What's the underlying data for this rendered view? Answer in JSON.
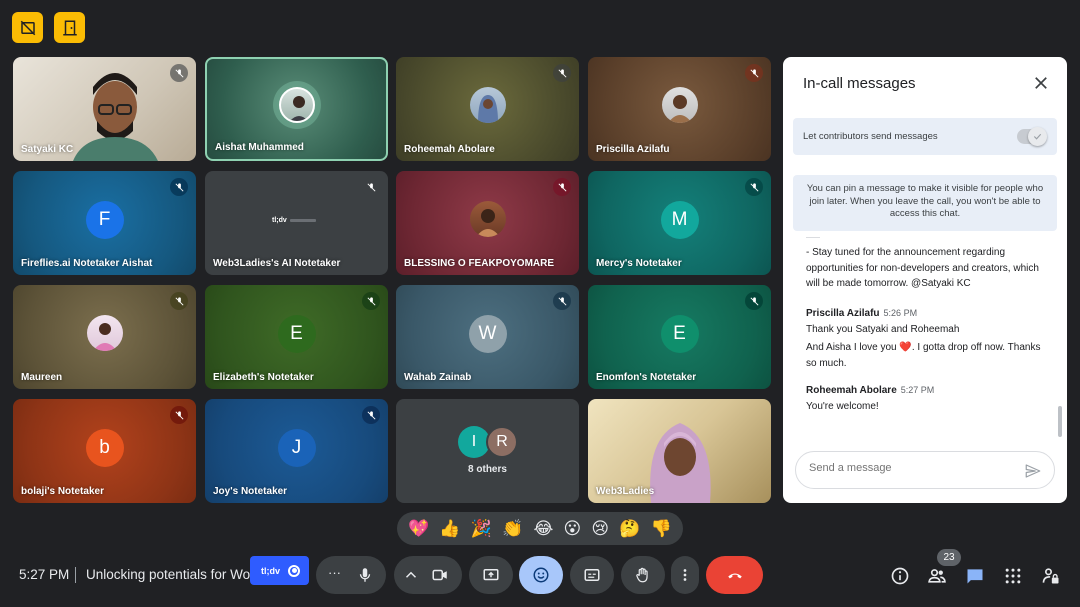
{
  "tiles": [
    {
      "name": "Satyaki KC",
      "muted": true
    },
    {
      "name": "Aishat Muhammed",
      "muted": false,
      "speaking": true
    },
    {
      "name": "Roheemah Abolare",
      "muted": true
    },
    {
      "name": "Priscilla Azilafu",
      "muted": true
    },
    {
      "name": "Fireflies.ai Notetaker Aishat",
      "initial": "F",
      "muted": true
    },
    {
      "name": "Web3Ladies's AI Notetaker",
      "muted": true,
      "logo_text": "tl;dv"
    },
    {
      "name": "BLESSING O FEAKPOYOMARE",
      "muted": true
    },
    {
      "name": "Mercy's Notetaker",
      "initial": "M",
      "muted": true
    },
    {
      "name": "Maureen",
      "muted": true
    },
    {
      "name": "Elizabeth's Notetaker",
      "initial": "E",
      "muted": true
    },
    {
      "name": "Wahab Zainab",
      "initial": "W",
      "muted": false
    },
    {
      "name": "Enomfon's Notetaker",
      "initial": "E",
      "muted": true
    },
    {
      "name": "bolaji's Notetaker",
      "initial": "b",
      "muted": true
    },
    {
      "name": "Joy's Notetaker",
      "initial": "J",
      "muted": true
    },
    {
      "name": "8 others",
      "initials": [
        "I",
        "R"
      ]
    },
    {
      "name": "Web3Ladies",
      "muted": false
    }
  ],
  "chat": {
    "title": "In-call messages",
    "setting_label": "Let contributors send messages",
    "setting_on": true,
    "pin_info": "You can pin a message to make it visible for people who join later. When you leave the call, you won't be able to access this chat.",
    "partial_line": "- Stay tuned for the announcement regarding opportunities for non-developers and creators, which will be made tomorrow. @Satyaki KC",
    "messages": [
      {
        "sender": "Priscilla Azilafu",
        "time": "5:26 PM",
        "lines": [
          "Thank you Satyaki and Roheemah",
          "And Aisha I love you ❤️. I gotta drop off now. Thanks so much."
        ]
      },
      {
        "sender": "Roheemah Abolare",
        "time": "5:27 PM",
        "lines": [
          "You're welcome!"
        ]
      }
    ],
    "compose_placeholder": "Send a message"
  },
  "reactions": [
    "💖",
    "👍",
    "🎉",
    "👏",
    "😂",
    "😮",
    "😢",
    "🤔",
    "👎"
  ],
  "bottom": {
    "time": "5:27 PM",
    "meeting_title": "Unlocking potentials for Wo",
    "tldv_label": "tl;dv",
    "participant_count": "23"
  }
}
